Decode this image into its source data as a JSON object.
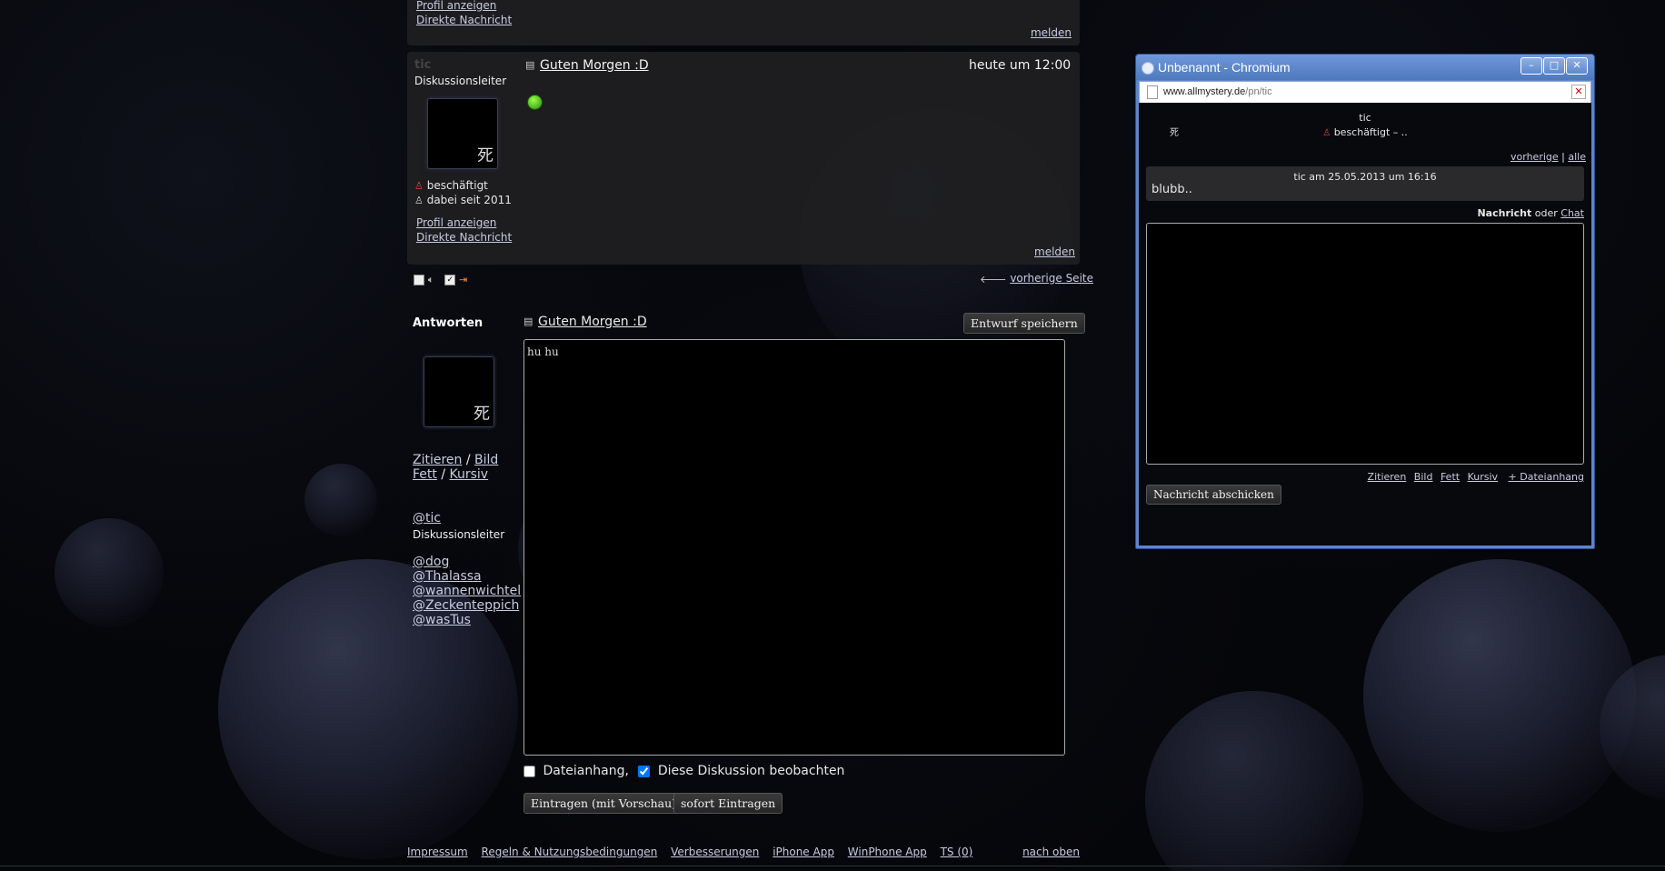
{
  "post1": {
    "profile_link": "Profil anzeigen",
    "pm_link": "Direkte Nachricht",
    "report_link": "melden"
  },
  "post2": {
    "username": "tic",
    "role": "Diskussionsleiter",
    "avatar_glyph": "死",
    "status": "beschäftigt",
    "member_since": "dabei seit 2011",
    "profile_link": "Profil anzeigen",
    "pm_link": "Direkte Nachricht",
    "report_link": "melden",
    "title": "Guten Morgen :D",
    "time": "heute um 12:00"
  },
  "toolbar": {
    "prev_page": "vorherige Seite"
  },
  "reply": {
    "heading": "Antworten",
    "avatar_glyph": "死",
    "quote": "Zitieren",
    "image": "Bild",
    "bold": "Fett",
    "italic": "Kursiv",
    "sep": "/",
    "mention_main": "@tic",
    "mention_main_role": "Diskussionsleiter",
    "mentions": [
      "@dog",
      "@Thalassa",
      "@wannenwichtel",
      "@Zeckenteppich",
      "@wasTus"
    ],
    "title": "Guten Morgen :D",
    "save_draft": "Entwurf speichern",
    "body": "hu hu",
    "attachment_label": "Dateianhang,",
    "watch_label": "Diese Diskussion beobachten",
    "attachment_checked": false,
    "watch_checked": true,
    "submit_preview": "Eintragen (mit Vorschau)",
    "submit_now": "sofort Eintragen"
  },
  "footer": {
    "links": [
      "Impressum",
      "Regeln & Nutzungsbedingungen",
      "Verbesserungen",
      "iPhone App",
      "WinPhone App",
      "TS (0)"
    ],
    "top": "nach oben"
  },
  "popup": {
    "window_title": "Unbenannt - Chromium",
    "url_host": "www.allmystery.de",
    "url_path": "/pn/tic",
    "username": "tic",
    "avatar_glyph": "死",
    "status": "beschäftigt – ..",
    "prev": "vorherige",
    "sep": "|",
    "all": "alle",
    "message_meta": "tic am 25.05.2013 um 16:16",
    "message_text": "blubb..",
    "compose_label": "Nachricht",
    "or": "oder",
    "chat": "Chat",
    "tools": [
      "Zitieren",
      "Bild",
      "Fett",
      "Kursiv",
      "+ Dateianhang"
    ],
    "send": "Nachricht abschicken"
  },
  "colors": {
    "window_blue": "#5d86c9",
    "panel": "#202022",
    "link": "#c7cbe0"
  }
}
